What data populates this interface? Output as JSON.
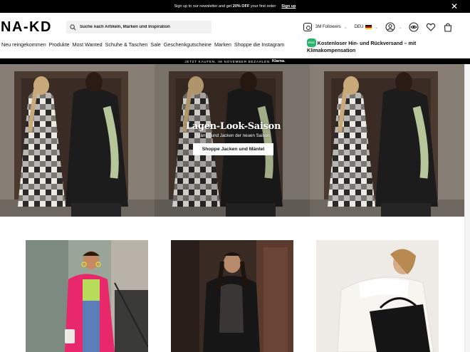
{
  "promo": {
    "text_before": "Sign up to our newsletter and get ",
    "text_bold": "20% OFF",
    "text_after": " your first order",
    "signup_label": "Sign up"
  },
  "header": {
    "logo": "NA-KD",
    "search_placeholder": "Suche nach Artikeln, Marken und Inspiration",
    "followers": "3M Followers",
    "country": "DEU"
  },
  "nav": {
    "items": [
      "Neu reingekommen",
      "Produkte",
      "Most Wanted",
      "Schuhe & Taschen",
      "Sale",
      "Geschenkgutscheine",
      "Marken",
      "Shoppe die Instagram"
    ]
  },
  "shipping": {
    "badge": "ECO",
    "text": "Kostenloser Hin- und Rückversand – mit Klimakompensation"
  },
  "klarna": {
    "text": "JETZT KAUFEN, IM NOVEMBER BEZAHLEN",
    "logo": "Klarna."
  },
  "hero": {
    "title": "Lagen-Look-Saison",
    "subtitle": "Mäntel und Jacken der neuen Saison",
    "button": "Shoppe Jacken und Mäntel"
  },
  "icons": {
    "instagram": "instagram-icon",
    "search": "search-icon",
    "account": "account-icon",
    "eye": "eye-icon",
    "wishlist": "heart-icon",
    "bag": "shopping-bag-icon",
    "close": "close-icon"
  },
  "colors": {
    "brand_black": "#000000",
    "eco_green": "#2ab36b",
    "coat_pink": "#e8286a"
  }
}
